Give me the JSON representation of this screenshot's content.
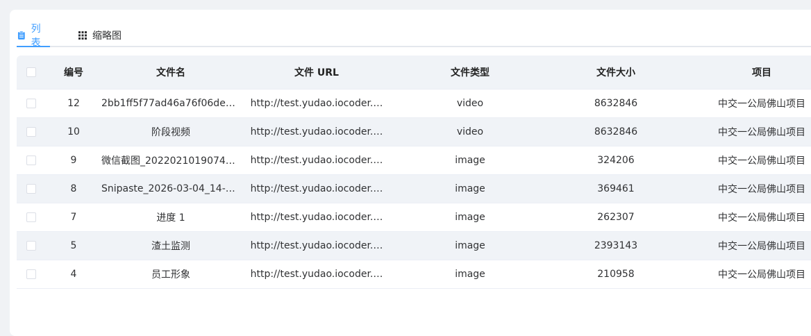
{
  "tabs": [
    {
      "label": "列表",
      "icon": "clipboard-list-icon",
      "active": true
    },
    {
      "label": "缩略图",
      "icon": "grid-icon",
      "active": false
    }
  ],
  "colors": {
    "accent": "#409eff",
    "header_bg": "#f0f3f7"
  },
  "table": {
    "headers": [
      "编号",
      "文件名",
      "文件 URL",
      "文件类型",
      "文件大小",
      "项目"
    ],
    "rows": [
      {
        "id": "12",
        "name": "2bb1ff5f77ad46a76f06de4…",
        "url": "http://test.yudao.iocoder.…",
        "type": "video",
        "size": "8632846",
        "project": "中交一公局佛山项目"
      },
      {
        "id": "10",
        "name": "阶段视频",
        "url": "http://test.yudao.iocoder.…",
        "type": "video",
        "size": "8632846",
        "project": "中交一公局佛山项目"
      },
      {
        "id": "9",
        "name": "微信截图_20220210190748…",
        "url": "http://test.yudao.iocoder.…",
        "type": "image",
        "size": "324206",
        "project": "中交一公局佛山项目"
      },
      {
        "id": "8",
        "name": "Snipaste_2026-03-04_14-4…",
        "url": "http://test.yudao.iocoder.…",
        "type": "image",
        "size": "369461",
        "project": "中交一公局佛山项目"
      },
      {
        "id": "7",
        "name": "进度 1",
        "url": "http://test.yudao.iocoder.…",
        "type": "image",
        "size": "262307",
        "project": "中交一公局佛山项目"
      },
      {
        "id": "5",
        "name": "渣土监测",
        "url": "http://test.yudao.iocoder.…",
        "type": "image",
        "size": "2393143",
        "project": "中交一公局佛山项目"
      },
      {
        "id": "4",
        "name": "员工形象",
        "url": "http://test.yudao.iocoder.…",
        "type": "image",
        "size": "210958",
        "project": "中交一公局佛山项目"
      }
    ]
  }
}
